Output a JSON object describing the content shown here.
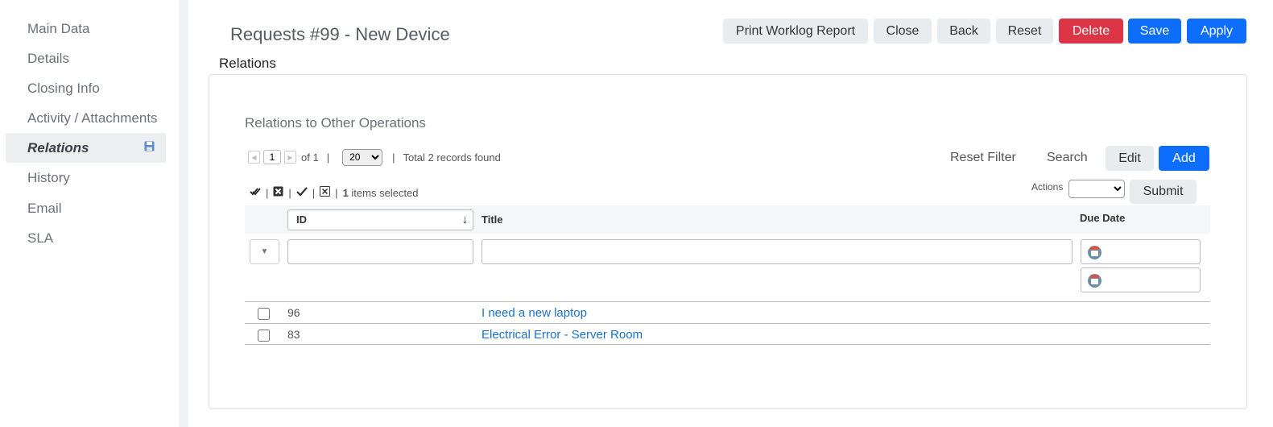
{
  "sidebar": {
    "items": [
      {
        "label": "Main Data"
      },
      {
        "label": "Details"
      },
      {
        "label": "Closing Info"
      },
      {
        "label": "Activity / Attachments"
      },
      {
        "label": "Relations",
        "active": true
      },
      {
        "label": "History"
      },
      {
        "label": "Email"
      },
      {
        "label": "SLA"
      }
    ]
  },
  "header": {
    "title": "Requests #99 - New Device",
    "section": "Relations"
  },
  "toolbar": {
    "print_worklog": "Print Worklog Report",
    "close": "Close",
    "back": "Back",
    "reset": "Reset",
    "delete": "Delete",
    "save": "Save",
    "apply": "Apply"
  },
  "panel": {
    "title": "Relations to Other Operations",
    "pager": {
      "page": "1",
      "of_label": "of 1",
      "page_size": "20",
      "page_size_options": [
        "20"
      ],
      "separator": "|",
      "total": "Total 2 records found"
    },
    "buttons": {
      "reset_filter": "Reset Filter",
      "search": "Search",
      "edit": "Edit",
      "add": "Add",
      "submit": "Submit"
    },
    "selection": {
      "separator": "|",
      "count": "1",
      "label": "items selected"
    },
    "actions_label": "Actions",
    "table": {
      "columns": {
        "id": "ID",
        "title": "Title",
        "due_date": "Due Date"
      },
      "rows": [
        {
          "id": "96",
          "title": "I need a new laptop"
        },
        {
          "id": "83",
          "title": "Electrical Error - Server Room"
        }
      ]
    }
  },
  "colors": {
    "primary": "#0d6efd",
    "danger": "#dc3545",
    "link": "#1a73c8"
  }
}
